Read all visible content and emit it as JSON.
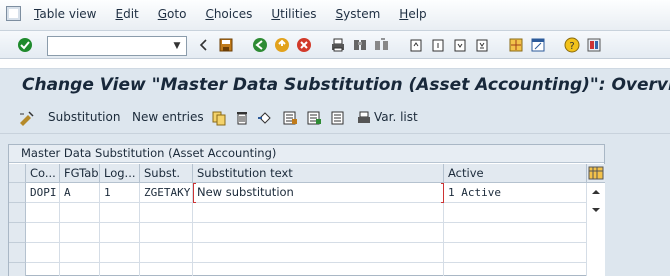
{
  "menu": {
    "items": [
      "Table view",
      "Edit",
      "Goto",
      "Choices",
      "Utilities",
      "System",
      "Help"
    ]
  },
  "toolbar": {
    "command_field": "",
    "icons": [
      "enter-icon",
      "command-dropdown-icon",
      "back-nav-icon",
      "save-icon",
      "back-icon",
      "exit-icon",
      "cancel-icon",
      "print-icon",
      "find-icon",
      "find-next-icon",
      "first-page-icon",
      "previous-page-icon",
      "next-page-icon",
      "last-page-icon",
      "create-session-icon",
      "shortcut-icon",
      "help-icon",
      "layout-menu-icon"
    ]
  },
  "title": {
    "text": "Change View \"Master Data Substitution (Asset Accounting)\": Overview"
  },
  "app_toolbar": {
    "substitution_label": "Substitution",
    "new_entries_label": "New entries",
    "var_list_label": "Var. list"
  },
  "table": {
    "title": "Master Data Substitution (Asset Accounting)",
    "columns": [
      "Co...",
      "FGTab",
      "Log...",
      "Subst.",
      "Substitution text",
      "Active"
    ],
    "rows": [
      [
        "DOPI",
        "A",
        "1",
        "ZGETAKY",
        "New substitution",
        "1 Active"
      ]
    ]
  },
  "colors": {
    "accent": "#dde6ee",
    "header": "#e2e9f0",
    "marker": "#cc3333"
  }
}
